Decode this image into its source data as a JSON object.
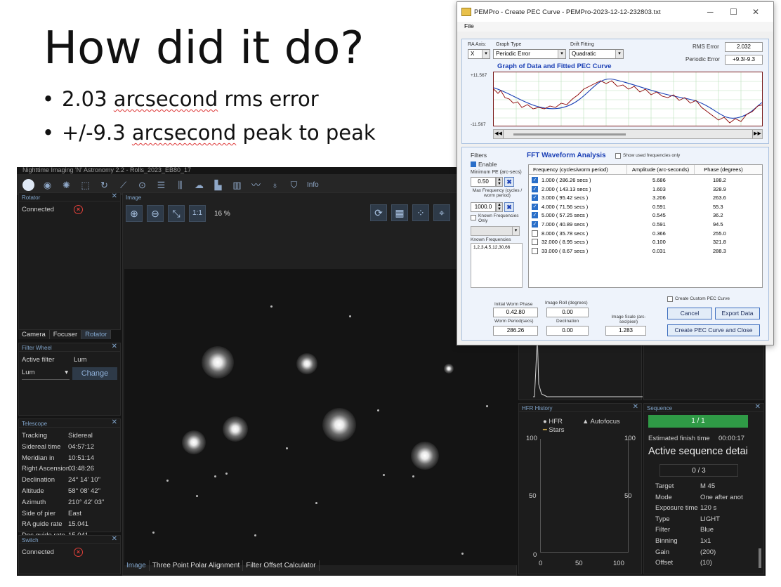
{
  "slide": {
    "title": "How did it do?",
    "bullets": [
      {
        "dot": "•",
        "text_plain": "2.03 ",
        "text_sq": "arcsecond",
        "text_rest": " rms error"
      },
      {
        "dot": "•",
        "text_plain": "+/-9.3 ",
        "text_sq": "arcsecond",
        "text_rest": " peak to peak"
      }
    ]
  },
  "nina": {
    "window_title": "Nighttime Imaging 'N' Astronomy 2.2 - Rolls_2023_EB80_17",
    "toolbar_info": "Info",
    "rotator": {
      "title": "Rotator",
      "connected": "Connected"
    },
    "left_tabs": [
      "Camera",
      "Focuser",
      "Rotator"
    ],
    "filter_wheel": {
      "title": "Filter Wheel",
      "active_filter_label": "Active filter",
      "active_filter_value": "Lum",
      "select_value": "Lum",
      "change": "Change"
    },
    "telescope": {
      "title": "Telescope",
      "rows": [
        {
          "label": "Tracking",
          "value": "Sidereal"
        },
        {
          "label": "Sidereal time",
          "value": "04:57:12"
        },
        {
          "label": "Meridian in",
          "value": "10:51:14"
        },
        {
          "label": "Right Ascension",
          "value": "03:48:26"
        },
        {
          "label": "Declination",
          "value": "24° 14' 10\""
        },
        {
          "label": "Altitude",
          "value": "58° 08' 42\""
        },
        {
          "label": "Azimuth",
          "value": "210° 42' 03\""
        },
        {
          "label": "Side of pier",
          "value": "East"
        },
        {
          "label": "RA guide rate",
          "value": "15.041"
        },
        {
          "label": "Dec guide rate",
          "value": "15.041"
        }
      ]
    },
    "switch": {
      "title": "Switch",
      "connected": "Connected"
    },
    "image": {
      "title": "Image",
      "one_to_one": "1:1",
      "zoom": "16 %"
    },
    "bottom_tabs": [
      "Image",
      "Three Point Polar Alignment",
      "Filter Offset Calculator"
    ],
    "hfr": {
      "title": "HFR History",
      "legend_hfr": "HFR",
      "legend_stars": "Stars",
      "legend_autofocus": "Autofocus",
      "y_left": [
        "100",
        "50",
        "0"
      ],
      "y_right": [
        "100",
        "50"
      ],
      "x_ticks": [
        "0",
        "50",
        "100"
      ]
    },
    "sequence": {
      "title": "Sequence",
      "progress": "1 / 1",
      "finish_label": "Estimated finish time",
      "finish_value": "00:00:17",
      "heading": "Active sequence detai",
      "counter": "0 / 3",
      "rows": [
        {
          "label": "Target",
          "value": "M 45"
        },
        {
          "label": "Mode",
          "value": "One after anot"
        },
        {
          "label": "Exposure time",
          "value": "120 s"
        },
        {
          "label": "Type",
          "value": "LIGHT"
        },
        {
          "label": "Filter",
          "value": "Blue"
        },
        {
          "label": "Binning",
          "value": "1x1"
        },
        {
          "label": "Gain",
          "value": "(200)"
        },
        {
          "label": "Offset",
          "value": "(10)"
        }
      ]
    }
  },
  "pem": {
    "title": "PEMPro - Create PEC Curve - PEMPro-2023-12-12-232803.txt",
    "menu_file": "File",
    "ra_axis_label": "RA Axis:",
    "ra_axis_value": "X",
    "graph_type_label": "Graph Type",
    "graph_type_value": "Periodic Error",
    "drift_label": "Drift Fitting",
    "drift_value": "Quadratic",
    "rms_label": "RMS Error",
    "rms_value": "2.032",
    "pe_label": "Periodic Error",
    "pe_value": "+9.3/-9.3",
    "graph_title": "Graph of Data and Fitted PEC Curve",
    "y_top": "+11.567",
    "y_bottom": "-11.567",
    "filters_title": "Filters",
    "enable": "Enable",
    "min_pe_label": "Minimum PE (arc-secs)",
    "min_pe_value": "0.50",
    "max_freq_label": "Max Frequency (cycles / worm period)",
    "max_freq_value": "1000.0",
    "known_only": "Known Frequencies Only",
    "known_freq_label": "Known Frequencies",
    "known_freq_value": "1,2,3,4,5,12,30,66",
    "fft_title": "FFT Waveform Analysis",
    "show_used": "Show used frequencies only",
    "col_freq": "Frequency (cycles/worm period)",
    "col_amp": "Amplitude (arc-seconds)",
    "col_phase": "Phase (degrees)",
    "fft_rows": [
      {
        "freq": "1.000  ( 286.26 secs )",
        "amp": "5.686",
        "phase": "188.2",
        "checked": true
      },
      {
        "freq": "2.000  ( 143.13 secs )",
        "amp": "1.603",
        "phase": "328.9",
        "checked": true
      },
      {
        "freq": "3.000  ( 95.42 secs )",
        "amp": "3.206",
        "phase": "263.6",
        "checked": true
      },
      {
        "freq": "4.000  ( 71.56 secs )",
        "amp": "0.591",
        "phase": "55.3",
        "checked": true
      },
      {
        "freq": "5.000  ( 57.25 secs )",
        "amp": "0.545",
        "phase": "36.2",
        "checked": true
      },
      {
        "freq": "7.000  ( 40.89 secs )",
        "amp": "0.591",
        "phase": "94.5",
        "checked": true
      },
      {
        "freq": "8.000  ( 35.78 secs )",
        "amp": "0.366",
        "phase": "255.0",
        "checked": false
      },
      {
        "freq": "32.000  ( 8.95 secs )",
        "amp": "0.100",
        "phase": "321.8",
        "checked": false
      },
      {
        "freq": "33.000  ( 8.67 secs )",
        "amp": "0.031",
        "phase": "288.3",
        "checked": false
      }
    ],
    "initial_worm_label": "Initial Worm Phase",
    "initial_worm_value": "0.42.80",
    "image_roll_label": "Image Roll (degrees)",
    "image_roll_value": "0.00",
    "worm_period_label": "Worm Period(secs)",
    "worm_period_value": "286.26",
    "declination_label": "Declination",
    "declination_value": "0.00",
    "image_scale_label": "Image Scale (arc-sec/pixel)",
    "image_scale_value": "1.283",
    "custom_pec": "Create Custom PEC Curve",
    "cancel": "Cancel",
    "export": "Export Data",
    "create_close": "Create PEC Curve and Close"
  },
  "colors": {
    "nina_bg": "#151515",
    "nina_accent": "#7fa3c9",
    "sequence_progress": "#2f9a46",
    "pem_graph_data": "#8b0000",
    "pem_graph_fit": "#1a3fb5",
    "pem_title": "#1a3fb5"
  }
}
